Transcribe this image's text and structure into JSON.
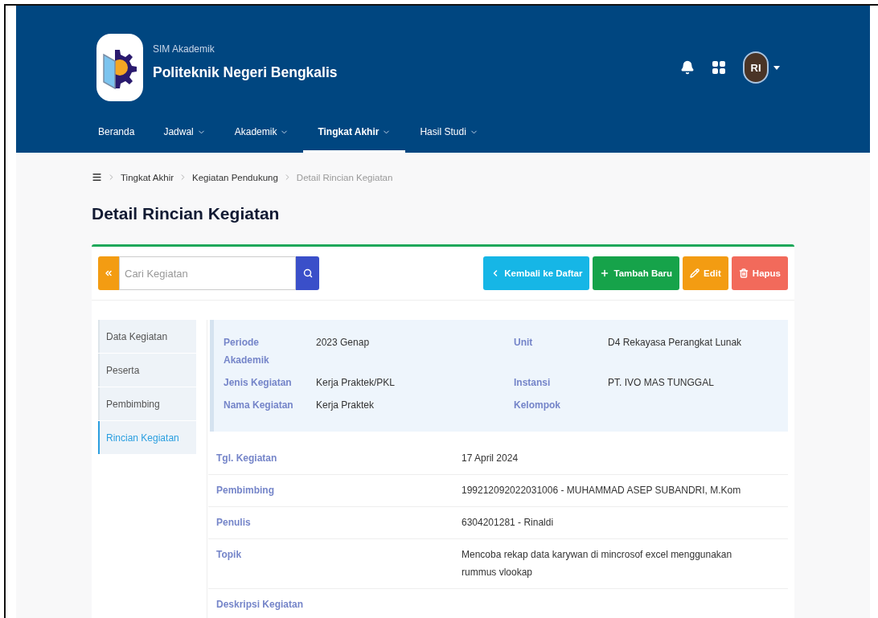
{
  "header": {
    "subtitle": "SIM Akademik",
    "title": "Politeknik Negeri Bengkalis",
    "avatar_initials": "RI"
  },
  "nav": [
    {
      "label": "Beranda",
      "dropdown": false,
      "selected": false
    },
    {
      "label": "Jadwal",
      "dropdown": true,
      "selected": false
    },
    {
      "label": "Akademik",
      "dropdown": true,
      "selected": false
    },
    {
      "label": "Tingkat Akhir",
      "dropdown": true,
      "selected": true
    },
    {
      "label": "Hasil Studi",
      "dropdown": true,
      "selected": false
    }
  ],
  "breadcrumb": [
    {
      "label": "Tingkat Akhir",
      "kind": "link"
    },
    {
      "label": "Kegiatan Pendukung",
      "kind": "link"
    },
    {
      "label": "Detail Rincian Kegiatan",
      "kind": "current"
    }
  ],
  "page_title": "Detail Rincian Kegiatan",
  "search": {
    "placeholder": "Cari Kegiatan"
  },
  "actions": [
    {
      "label": "Kembali ke Daftar",
      "kind": "back"
    },
    {
      "label": "Tambah Baru",
      "kind": "add"
    },
    {
      "label": "Edit",
      "kind": "edit"
    },
    {
      "label": "Hapus",
      "kind": "delete"
    }
  ],
  "side_tabs": [
    {
      "label": "Data Kegiatan",
      "selected": false
    },
    {
      "label": "Peserta",
      "selected": false
    },
    {
      "label": "Pembimbing",
      "selected": false
    },
    {
      "label": "Rincian Kegiatan",
      "selected": true
    }
  ],
  "info": [
    {
      "label": "Periode Akademik",
      "value": "2023 Genap"
    },
    {
      "label": "Unit",
      "value": "D4 Rekayasa Perangkat Lunak"
    },
    {
      "label": "Jenis Kegiatan",
      "value": "Kerja Praktek/PKL"
    },
    {
      "label": "Instansi",
      "value": "PT. IVO MAS TUNGGAL"
    },
    {
      "label": "Nama Kegiatan",
      "value": "Kerja Praktek"
    },
    {
      "label": "Kelompok"
    }
  ],
  "details": [
    {
      "label": "Tgl. Kegiatan",
      "value": "17 April 2024"
    },
    {
      "label": "Pembimbing",
      "value": "199212092022031006 - MUHAMMAD ASEP SUBANDRI, M.Kom"
    },
    {
      "label": "Penulis",
      "value": "6304201281 - Rinaldi"
    },
    {
      "label": "Topik",
      "value": "Mencoba rekap data karywan di mincrosof excel menggunakan rummus vlookap"
    },
    {
      "label": "Deskripsi Kegiatan"
    }
  ]
}
